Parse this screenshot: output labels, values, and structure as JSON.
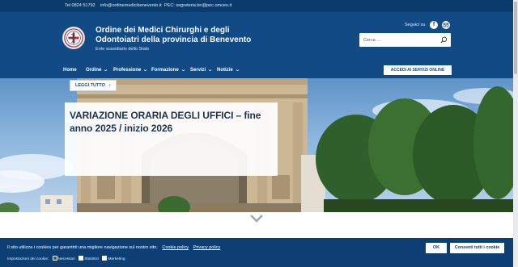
{
  "topbar": {
    "phone": "Tel 0824 51792",
    "email": "info@ordinemedicibenevento.it",
    "pec": "PEC: segreteria.bn@pec.omceo.it"
  },
  "header": {
    "title": "Ordine dei Medici Chirurghi e degli Odontoiatri della provincia di Benevento",
    "subtitle": "Ente sussidiario dello Stato",
    "social_label": "Seguici su",
    "social_icons": [
      "facebook-icon",
      "mail-icon"
    ],
    "search_placeholder": "Cerca ..."
  },
  "nav": {
    "items": [
      {
        "label": "Home",
        "has_dropdown": false
      },
      {
        "label": "Ordine",
        "has_dropdown": true
      },
      {
        "label": "Professione",
        "has_dropdown": true
      },
      {
        "label": "Formazione",
        "has_dropdown": true
      },
      {
        "label": "Servizi",
        "has_dropdown": true
      },
      {
        "label": "Notizie",
        "has_dropdown": true
      }
    ],
    "cta_label": "ACCEDI AI SERVIZI ONLINE"
  },
  "hero": {
    "title": "VARIAZIONE ORARIA DEGLI UFFICI – fine anno 2025 / inizio 2026",
    "button_label": "LEGGI TUTTO"
  },
  "cookie": {
    "text": "Il sito utilizza i cookies per garantirti una migliore navigazione sul nostro sito.",
    "policy_link": "Cookie policy",
    "privacy_link": "Privacy policy",
    "prefs_label": "Impostazioni dei cookie:",
    "options": [
      {
        "label": "Necessari",
        "checked": true
      },
      {
        "label": "Statistici",
        "checked": false
      },
      {
        "label": "Marketing",
        "checked": false
      }
    ],
    "ok_label": "OK",
    "accept_all_label": "Consenti tutti i cookie"
  },
  "colors": {
    "primary": "#124a85",
    "topbar": "#0a3b6d",
    "cookie_bar": "#0d3f75",
    "hero_title": "#19324f"
  }
}
